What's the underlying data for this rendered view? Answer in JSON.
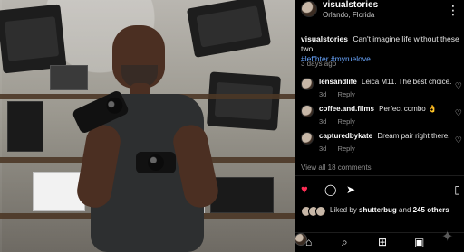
{
  "header": {
    "username": "visualstories",
    "location": "Orlando, Florida",
    "more_label": "⋮"
  },
  "post": {
    "caption_username": "visualstories",
    "caption_text": "Can't imagine life without these two.",
    "hashtags": "#leffhter #myruelove",
    "time": "3 days ago"
  },
  "comments": [
    {
      "username": "lensandlife",
      "text": "Leica M11. The best choice.",
      "age": "3d",
      "reply_label": "Reply"
    },
    {
      "username": "coffee.and.films",
      "text": "Perfect combo 👌",
      "age": "3d",
      "reply_label": "Reply"
    },
    {
      "username": "capturedbykate",
      "text": "Dream pair right there.",
      "age": "3d",
      "reply_label": "Reply"
    }
  ],
  "view_all": "View all 18 comments",
  "likes": {
    "prefix": "Liked by",
    "user": "shutterbug",
    "and": "and",
    "others": "245 others"
  },
  "icons": {
    "like": "♥",
    "comment": "◯",
    "share": "➤",
    "save": "▯",
    "comment_like": "♡",
    "home": "⌂",
    "search": "⌕",
    "create": "⊞",
    "reels": "▣",
    "sparkle": "✦"
  },
  "colors": {
    "like_red": "#ff2d55",
    "link_blue": "#6aa7ff",
    "muted": "#8e8e8e"
  }
}
